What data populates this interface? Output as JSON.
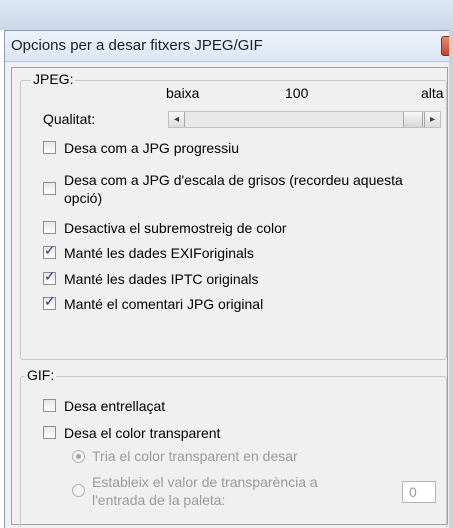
{
  "dialog": {
    "title": "Opcions per a desar fitxers JPEG/GIF"
  },
  "jpeg": {
    "legend": "JPEG:",
    "quality": {
      "label": "Qualitat:",
      "min_label": "baixa",
      "value": "100",
      "max_label": "alta",
      "left_arrow": "◂",
      "right_arrow": "▸",
      "level": 1.0
    },
    "options": [
      {
        "label": "Desa com a JPG progressiu",
        "checked": false
      },
      {
        "label": "Desa com a JPG d'escala de grisos (recordeu aquesta opció)",
        "checked": false
      },
      {
        "label": "Desactiva el subremostreig de color",
        "checked": false
      },
      {
        "label": "Manté les dades EXIForiginals",
        "checked": true
      },
      {
        "label": "Manté les dades IPTC originals",
        "checked": true
      },
      {
        "label": "Manté el comentari JPG original",
        "checked": true
      }
    ]
  },
  "gif": {
    "legend": "GIF:",
    "options": [
      {
        "label": "Desa entrellaçat",
        "checked": false
      },
      {
        "label": "Desa el color transparent",
        "checked": false
      }
    ],
    "radios": [
      {
        "label": "Tria el color transparent en desar",
        "checked": true
      },
      {
        "label": "Estableix el valor de transparència a l'entrada de la paleta:",
        "checked": false
      }
    ],
    "palette_value": "0"
  }
}
